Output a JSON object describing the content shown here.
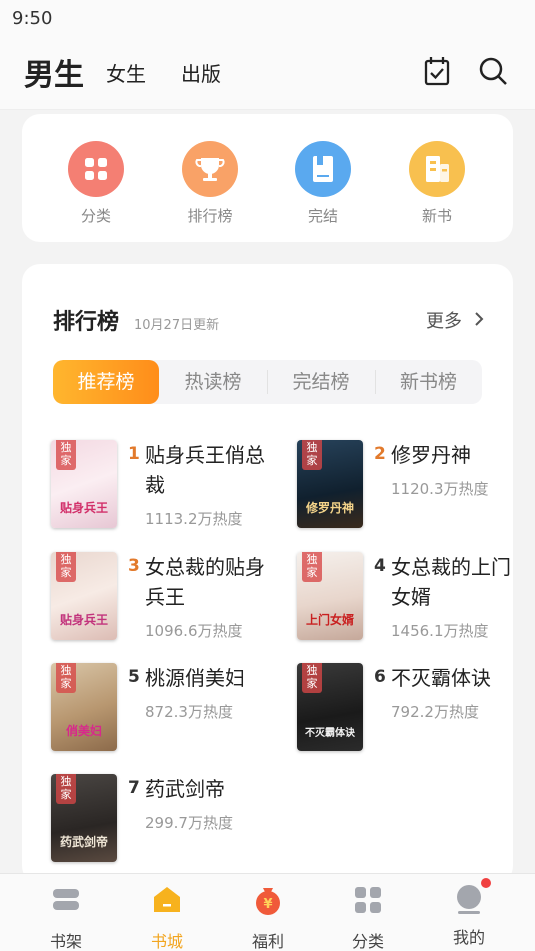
{
  "status": {
    "time": "9:50"
  },
  "top_nav": {
    "tabs": [
      "男生",
      "女生",
      "出版"
    ],
    "active": "男生",
    "icons": [
      "calendar-check-icon",
      "search-icon"
    ]
  },
  "categories": [
    {
      "label": "分类",
      "icon": "grid-icon",
      "color": "#f47f73"
    },
    {
      "label": "排行榜",
      "icon": "trophy-icon",
      "color": "#f9a267"
    },
    {
      "label": "完结",
      "icon": "book-icon",
      "color": "#5aa9ef"
    },
    {
      "label": "新书",
      "icon": "building-icon",
      "color": "#f8c04f"
    }
  ],
  "ranking": {
    "title": "排行榜",
    "updated": "10月27日更新",
    "more": "更多",
    "tabs": [
      "推荐榜",
      "热读榜",
      "完结榜",
      "新书榜"
    ],
    "active_tab": "推荐榜",
    "books": [
      {
        "rank": "1",
        "title": "贴身兵王俏总裁",
        "heat": "1113.2万热度",
        "badge": "独家",
        "cover_text": "贴身兵王"
      },
      {
        "rank": "2",
        "title": "修罗丹神",
        "heat": "1120.3万热度",
        "badge": "独家",
        "cover_text": "修罗丹神"
      },
      {
        "rank": "3",
        "title": "女总裁的贴身兵王",
        "heat": "1096.6万热度",
        "badge": "独家",
        "cover_text": "贴身兵王"
      },
      {
        "rank": "4",
        "title": "女总裁的上门女婿",
        "heat": "1456.1万热度",
        "badge": "独家",
        "cover_text": "上门女婿"
      },
      {
        "rank": "5",
        "title": "桃源俏美妇",
        "heat": "872.3万热度",
        "badge": "独家",
        "cover_text": "俏美妇"
      },
      {
        "rank": "6",
        "title": "不灭霸体诀",
        "heat": "792.2万热度",
        "badge": "独家",
        "cover_text": "不灭霸体诀"
      },
      {
        "rank": "7",
        "title": "药武剑帝",
        "heat": "299.7万热度",
        "badge": "独家",
        "cover_text": "药武剑帝"
      }
    ]
  },
  "bottom_nav": [
    {
      "label": "书架",
      "icon": "bookshelf-icon"
    },
    {
      "label": "书城",
      "icon": "bookstore-icon",
      "active": true
    },
    {
      "label": "福利",
      "icon": "red-envelope-icon"
    },
    {
      "label": "分类",
      "icon": "grid-icon"
    },
    {
      "label": "我的",
      "icon": "profile-icon",
      "notification": true
    }
  ]
}
